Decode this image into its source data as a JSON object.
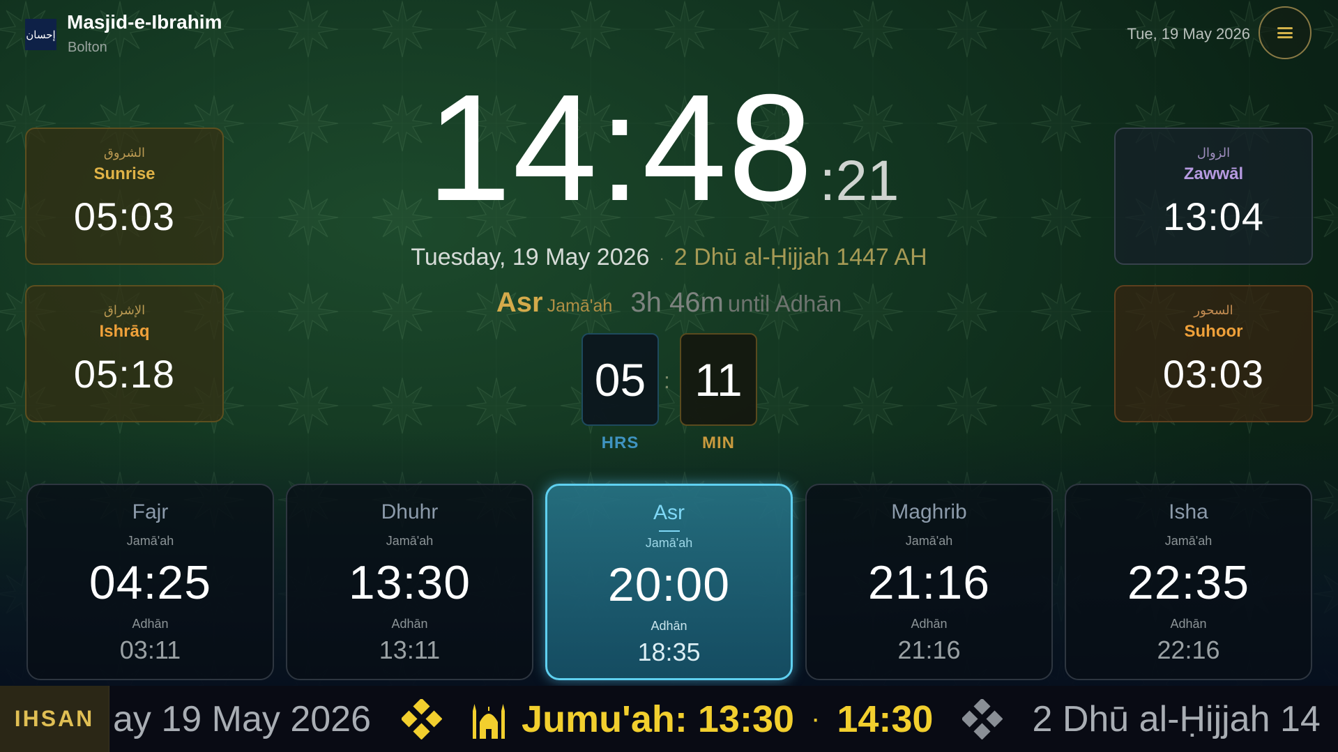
{
  "header": {
    "logo_text": "إحسان",
    "mosque_name": "Masjid-e-Ibrahim",
    "city": "Bolton",
    "date": "Tue, 19 May 2026"
  },
  "side_cards": {
    "sunrise": {
      "arabic": "الشروق",
      "label": "Sunrise",
      "time": "05:03"
    },
    "ishraq": {
      "arabic": "الإشراق",
      "label": "Ishrāq",
      "time": "05:18"
    },
    "zawwal": {
      "arabic": "الزوال",
      "label": "Zawwāl",
      "time": "13:04"
    },
    "suhoor": {
      "arabic": "السحور",
      "label": "Suhoor",
      "time": "03:03"
    }
  },
  "clock": {
    "hm": "14:48",
    "seconds": ":21",
    "gregorian": "Tuesday, 19 May 2026",
    "separator": "·",
    "hijri": "2 Dhū al-Ḥijjah 1447 AH"
  },
  "next": {
    "prayer": "Asr",
    "type": "Jamā'ah",
    "remaining": "3h 46m",
    "suffix": "until Adhān"
  },
  "countdown": {
    "hours": "05",
    "minutes": "11",
    "separator": ":",
    "hours_label": "HRS",
    "minutes_label": "MIN"
  },
  "prayers": [
    {
      "name": "Fajr",
      "jamaah_label": "Jamā'ah",
      "jamaah": "04:25",
      "adhan_label": "Adhān",
      "adhan": "03:11"
    },
    {
      "name": "Dhuhr",
      "jamaah_label": "Jamā'ah",
      "jamaah": "13:30",
      "adhan_label": "Adhān",
      "adhan": "13:11"
    },
    {
      "name": "Asr",
      "jamaah_label": "Jamā'ah",
      "jamaah": "20:00",
      "adhan_label": "Adhān",
      "adhan": "18:35"
    },
    {
      "name": "Maghrib",
      "jamaah_label": "Jamā'ah",
      "jamaah": "21:16",
      "adhan_label": "Adhān",
      "adhan": "21:16"
    },
    {
      "name": "Isha",
      "jamaah_label": "Jamā'ah",
      "jamaah": "22:35",
      "adhan_label": "Adhān",
      "adhan": "22:16"
    }
  ],
  "active_prayer_index": 2,
  "ticker": {
    "brand": "IHSAN",
    "date_fragment": "ay 19 May 2026",
    "jumuah_1": "Jumu'ah: 13:30",
    "dot": "·",
    "jumuah_2": "14:30",
    "hijri_fragment": "2 Dhū al-Ḥijjah 14"
  },
  "colors": {
    "accent_gold": "#e0b347",
    "accent_cyan": "#5fd0f0",
    "ticker_yellow": "#f2cf2e",
    "background_green": "#123420"
  },
  "icons": [
    "menu-icon",
    "diamond-icon",
    "mosque-icon"
  ]
}
